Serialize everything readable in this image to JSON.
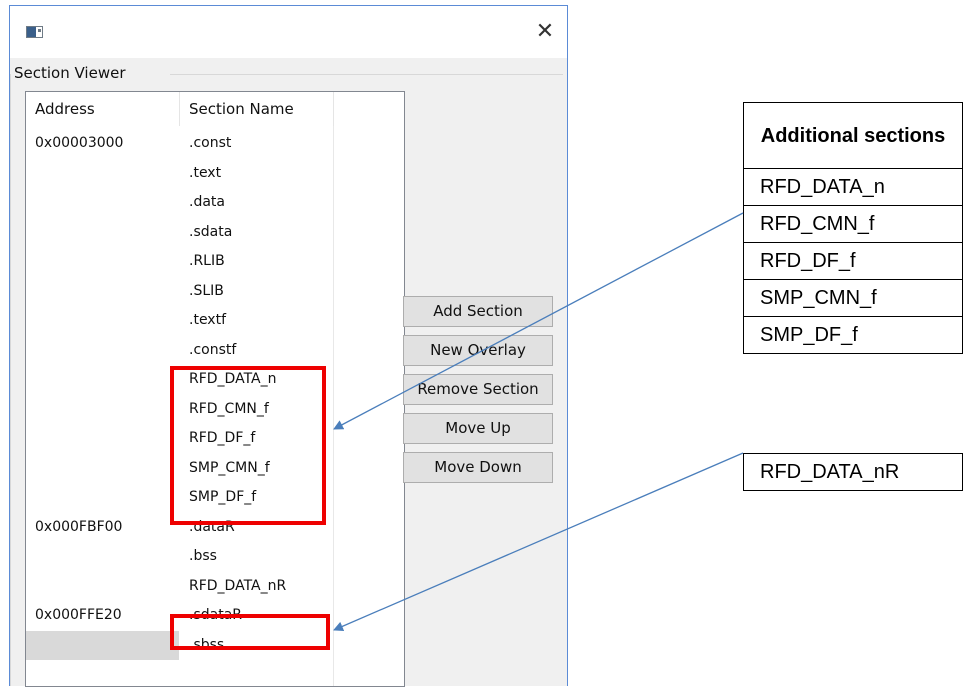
{
  "window": {
    "close_symbol": "✕",
    "group_label": "Section Viewer"
  },
  "list": {
    "columns": [
      "Address",
      "Section Name"
    ],
    "rows": [
      {
        "address": "0x00003000",
        "name": ".const"
      },
      {
        "address": "",
        "name": ".text"
      },
      {
        "address": "",
        "name": ".data"
      },
      {
        "address": "",
        "name": ".sdata"
      },
      {
        "address": "",
        "name": ".RLIB"
      },
      {
        "address": "",
        "name": ".SLIB"
      },
      {
        "address": "",
        "name": ".textf"
      },
      {
        "address": "",
        "name": ".constf"
      },
      {
        "address": "",
        "name": "RFD_DATA_n"
      },
      {
        "address": "",
        "name": "RFD_CMN_f"
      },
      {
        "address": "",
        "name": "RFD_DF_f"
      },
      {
        "address": "",
        "name": "SMP_CMN_f"
      },
      {
        "address": "",
        "name": "SMP_DF_f"
      },
      {
        "address": "0x000FBF00",
        "name": ".dataR"
      },
      {
        "address": "",
        "name": ".bss"
      },
      {
        "address": "",
        "name": "RFD_DATA_nR"
      },
      {
        "address": "0x000FFE20",
        "name": ".sdataR"
      },
      {
        "address": "",
        "name": ".sbss"
      }
    ]
  },
  "buttons": {
    "add_section": "Add Section",
    "new_overlay": "New Overlay",
    "remove_section": "Remove Section",
    "move_up": "Move Up",
    "move_down": "Move Down"
  },
  "annotations": {
    "additional_header": "Additional sections",
    "additional_items": [
      "RFD_DATA_n",
      "RFD_CMN_f",
      "RFD_DF_f",
      "SMP_CMN_f",
      "SMP_DF_f"
    ],
    "r_item": "RFD_DATA_nR",
    "highlight_color": "#ee0000",
    "arrow_color": "#4a7ebb"
  }
}
